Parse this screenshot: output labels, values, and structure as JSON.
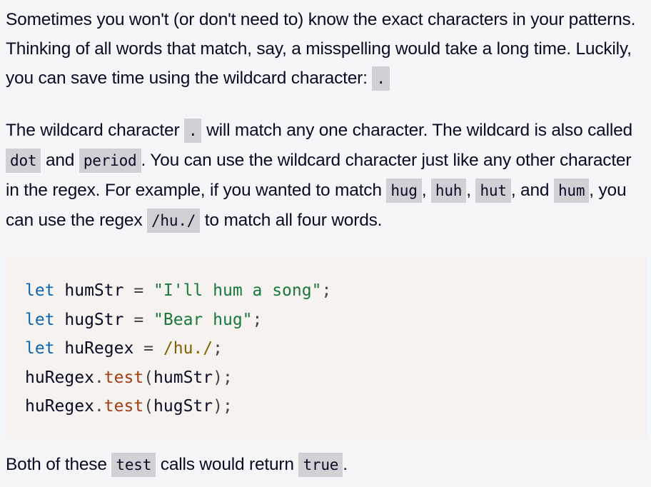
{
  "paragraphs": {
    "p1": {
      "text": "Sometimes you won't (or don't need to) know the exact characters in your patterns. Thinking of all words that match, say, a misspelling would take a long time. Luckily, you can save time using the wildcard character: ",
      "code": "."
    },
    "p2": {
      "t1": "The wildcard character ",
      "c1": ".",
      "t2": " will match any one character. The wildcard is also called ",
      "c2": "dot",
      "t3": " and ",
      "c3": "period",
      "t4": ". You can use the wildcard character just like any other character in the regex. For example, if you wanted to match ",
      "c4": "hug",
      "t5": ", ",
      "c5": "huh",
      "t6": ", ",
      "c6": "hut",
      "t7": ", and ",
      "c7": "hum",
      "t8": ", you can use the regex ",
      "c8": "/hu./",
      "t9": " to match all four words."
    },
    "p3": {
      "t1": "Both of these ",
      "c1": "test",
      "t2": " calls would return ",
      "c2": "true",
      "t3": "."
    }
  },
  "code_block": {
    "line1": {
      "kw": "let",
      "id": " humStr ",
      "op": "=",
      "sp": " ",
      "str": "\"I'll hum a song\"",
      "semi": ";"
    },
    "line2": {
      "kw": "let",
      "id": " hugStr ",
      "op": "=",
      "sp": " ",
      "str": "\"Bear hug\"",
      "semi": ";"
    },
    "line3": {
      "kw": "let",
      "id": " huRegex ",
      "op": "=",
      "sp": " ",
      "re": "/hu./",
      "semi": ";"
    },
    "line4": {
      "obj": "huRegex",
      "dot": ".",
      "fn": "test",
      "open": "(",
      "arg": "humStr",
      "close": ")",
      "semi": ";"
    },
    "line5": {
      "obj": "huRegex",
      "dot": ".",
      "fn": "test",
      "open": "(",
      "arg": "hugStr",
      "close": ")",
      "semi": ";"
    }
  }
}
